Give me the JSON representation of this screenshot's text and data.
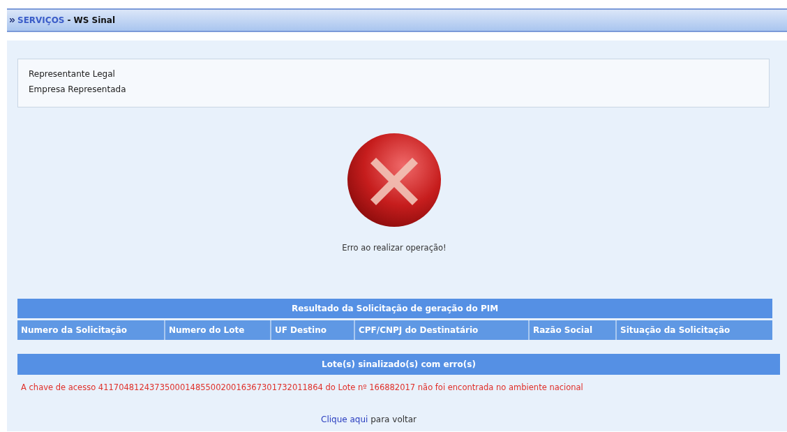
{
  "header": {
    "section": "SERVIÇOS",
    "separator": "-",
    "title": "WS Sinal"
  },
  "info": {
    "labels": [
      "Representante Legal",
      "Empresa Representada"
    ]
  },
  "status": {
    "kind": "error",
    "message": "Erro ao realizar operação!"
  },
  "result_table": {
    "title": "Resultado da Solicitação de geração do PIM",
    "columns": [
      "Numero da Solicitação",
      "Numero do Lote",
      "UF Destino",
      "CPF/CNPJ do Destinatário",
      "Razão Social",
      "Situação da Solicitação"
    ]
  },
  "error_section": {
    "title": "Lote(s) sinalizado(s) com erro(s)",
    "messages": [
      "A chave de acesso 41170481243735000148550020016367301732011864 do Lote nº 166882017 não foi encontrada no ambiente nacional"
    ]
  },
  "back_link": {
    "link": "Clique aqui",
    "text": "para voltar"
  }
}
